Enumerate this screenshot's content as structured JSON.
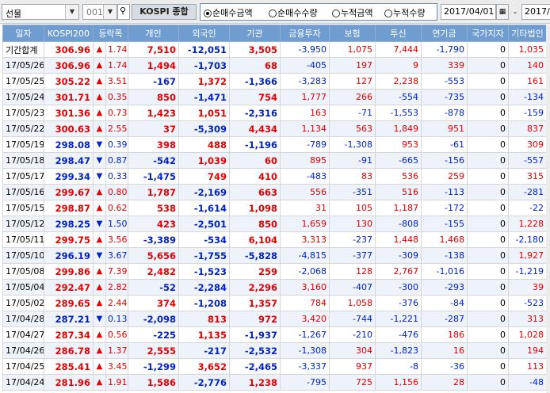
{
  "toolbar": {
    "category_value": "선물",
    "code_value": "001",
    "index_button": "KOSPI 종합",
    "radios": [
      "순매수금액",
      "순매수수량",
      "누적금액",
      "누적수량"
    ],
    "selected_radio": 0,
    "date_from": "2017/04/01",
    "date_to": "2017/",
    "range_sep": "-"
  },
  "table": {
    "headers": [
      "일자",
      "KOSPI200",
      "등락폭",
      "",
      "개인",
      "외국인",
      "기관",
      "금융투자",
      "보험",
      "투신",
      "연기금",
      "국가지자",
      "기타법인"
    ],
    "rows": [
      {
        "date": "기간합계",
        "kospi": "306.96",
        "dir": "up",
        "chg": "1.74",
        "indiv": "7,510",
        "foreign": "-12,051",
        "inst": "3,505",
        "fin": "-3,950",
        "ins": "1,075",
        "trust": "7,444",
        "pension": "-1,790",
        "gov": "0",
        "etc": "1,035"
      },
      {
        "date": "17/05/26",
        "kospi": "306.96",
        "dir": "up",
        "chg": "1.74",
        "indiv": "1,494",
        "foreign": "-1,703",
        "inst": "68",
        "fin": "-405",
        "ins": "197",
        "trust": "9",
        "pension": "339",
        "gov": "0",
        "etc": "140"
      },
      {
        "date": "17/05/25",
        "kospi": "305.22",
        "dir": "up",
        "chg": "3.51",
        "indiv": "-167",
        "foreign": "1,372",
        "inst": "-1,366",
        "fin": "-3,283",
        "ins": "127",
        "trust": "2,238",
        "pension": "-553",
        "gov": "0",
        "etc": "161"
      },
      {
        "date": "17/05/24",
        "kospi": "301.71",
        "dir": "up",
        "chg": "0.35",
        "indiv": "850",
        "foreign": "-1,471",
        "inst": "754",
        "fin": "1,777",
        "ins": "266",
        "trust": "-554",
        "pension": "-735",
        "gov": "0",
        "etc": "-134"
      },
      {
        "date": "17/05/23",
        "kospi": "301.36",
        "dir": "up",
        "chg": "0.73",
        "indiv": "1,423",
        "foreign": "1,051",
        "inst": "-2,316",
        "fin": "163",
        "ins": "-71",
        "trust": "-1,553",
        "pension": "-878",
        "gov": "0",
        "etc": "-159"
      },
      {
        "date": "17/05/22",
        "kospi": "300.63",
        "dir": "up",
        "chg": "2.55",
        "indiv": "37",
        "foreign": "-5,309",
        "inst": "4,434",
        "fin": "1,134",
        "ins": "563",
        "trust": "1,849",
        "pension": "951",
        "gov": "0",
        "etc": "837"
      },
      {
        "date": "17/05/19",
        "kospi": "298.08",
        "dir": "down",
        "chg": "0.39",
        "indiv": "398",
        "foreign": "488",
        "inst": "-1,196",
        "fin": "-789",
        "ins": "-1,308",
        "trust": "953",
        "pension": "-61",
        "gov": "0",
        "etc": "309"
      },
      {
        "date": "17/05/18",
        "kospi": "298.47",
        "dir": "down",
        "chg": "0.87",
        "indiv": "-542",
        "foreign": "1,039",
        "inst": "60",
        "fin": "895",
        "ins": "-91",
        "trust": "-665",
        "pension": "-156",
        "gov": "0",
        "etc": "-557"
      },
      {
        "date": "17/05/17",
        "kospi": "299.34",
        "dir": "down",
        "chg": "0.33",
        "indiv": "-1,475",
        "foreign": "749",
        "inst": "410",
        "fin": "-483",
        "ins": "83",
        "trust": "536",
        "pension": "259",
        "gov": "0",
        "etc": "315"
      },
      {
        "date": "17/05/16",
        "kospi": "299.67",
        "dir": "up",
        "chg": "0.80",
        "indiv": "1,787",
        "foreign": "-2,169",
        "inst": "663",
        "fin": "556",
        "ins": "-351",
        "trust": "516",
        "pension": "-113",
        "gov": "0",
        "etc": "-281"
      },
      {
        "date": "17/05/15",
        "kospi": "298.87",
        "dir": "up",
        "chg": "0.62",
        "indiv": "538",
        "foreign": "-1,614",
        "inst": "1,098",
        "fin": "31",
        "ins": "105",
        "trust": "1,187",
        "pension": "-172",
        "gov": "0",
        "etc": "-22"
      },
      {
        "date": "17/05/12",
        "kospi": "298.25",
        "dir": "down",
        "chg": "1.50",
        "indiv": "423",
        "foreign": "-2,501",
        "inst": "850",
        "fin": "1,659",
        "ins": "130",
        "trust": "-808",
        "pension": "-155",
        "gov": "0",
        "etc": "1,228"
      },
      {
        "date": "17/05/11",
        "kospi": "299.75",
        "dir": "up",
        "chg": "3.56",
        "indiv": "-3,389",
        "foreign": "-534",
        "inst": "6,104",
        "fin": "3,313",
        "ins": "-237",
        "trust": "1,448",
        "pension": "1,468",
        "gov": "0",
        "etc": "-2,180"
      },
      {
        "date": "17/05/10",
        "kospi": "296.19",
        "dir": "down",
        "chg": "3.67",
        "indiv": "5,656",
        "foreign": "-1,755",
        "inst": "-5,828",
        "fin": "-4,815",
        "ins": "-377",
        "trust": "-309",
        "pension": "-138",
        "gov": "0",
        "etc": "1,927"
      },
      {
        "date": "17/05/08",
        "kospi": "299.86",
        "dir": "up",
        "chg": "7.39",
        "indiv": "2,482",
        "foreign": "-1,523",
        "inst": "259",
        "fin": "-2,068",
        "ins": "128",
        "trust": "2,767",
        "pension": "-1,016",
        "gov": "0",
        "etc": "-1,219"
      },
      {
        "date": "17/05/04",
        "kospi": "292.47",
        "dir": "up",
        "chg": "2.82",
        "indiv": "-52",
        "foreign": "-2,284",
        "inst": "2,296",
        "fin": "3,160",
        "ins": "-407",
        "trust": "-300",
        "pension": "-293",
        "gov": "0",
        "etc": "39"
      },
      {
        "date": "17/05/02",
        "kospi": "289.65",
        "dir": "up",
        "chg": "2.44",
        "indiv": "374",
        "foreign": "-1,208",
        "inst": "1,357",
        "fin": "784",
        "ins": "1,058",
        "trust": "-376",
        "pension": "-84",
        "gov": "0",
        "etc": "-523"
      },
      {
        "date": "17/04/28",
        "kospi": "287.21",
        "dir": "down",
        "chg": "0.13",
        "indiv": "-2,098",
        "foreign": "813",
        "inst": "972",
        "fin": "3,420",
        "ins": "-744",
        "trust": "-1,221",
        "pension": "-287",
        "gov": "0",
        "etc": "313"
      },
      {
        "date": "17/04/27",
        "kospi": "287.34",
        "dir": "up",
        "chg": "0.56",
        "indiv": "-225",
        "foreign": "1,135",
        "inst": "-1,937",
        "fin": "-1,267",
        "ins": "-210",
        "trust": "-476",
        "pension": "186",
        "gov": "0",
        "etc": "1,028"
      },
      {
        "date": "17/04/26",
        "kospi": "286.78",
        "dir": "up",
        "chg": "1.37",
        "indiv": "2,555",
        "foreign": "-217",
        "inst": "-2,532",
        "fin": "-1,308",
        "ins": "304",
        "trust": "-1,823",
        "pension": "16",
        "gov": "0",
        "etc": "194"
      },
      {
        "date": "17/04/25",
        "kospi": "285.41",
        "dir": "up",
        "chg": "3.45",
        "indiv": "-1,299",
        "foreign": "3,652",
        "inst": "-2,465",
        "fin": "-3,337",
        "ins": "937",
        "trust": "-8",
        "pension": "-36",
        "gov": "0",
        "etc": "113"
      },
      {
        "date": "17/04/24",
        "kospi": "281.96",
        "dir": "up",
        "chg": "1.91",
        "indiv": "1,586",
        "foreign": "-2,776",
        "inst": "1,238",
        "fin": "-795",
        "ins": "725",
        "trust": "1,156",
        "pension": "28",
        "gov": "0",
        "etc": "-48"
      }
    ]
  },
  "colors": {
    "up": "#e60000",
    "down": "#0022cc",
    "header_bg": "#6f9dd2"
  },
  "icons": {
    "up": "triangle-up-icon",
    "down": "triangle-down-icon",
    "calendar": "calendar-icon"
  }
}
